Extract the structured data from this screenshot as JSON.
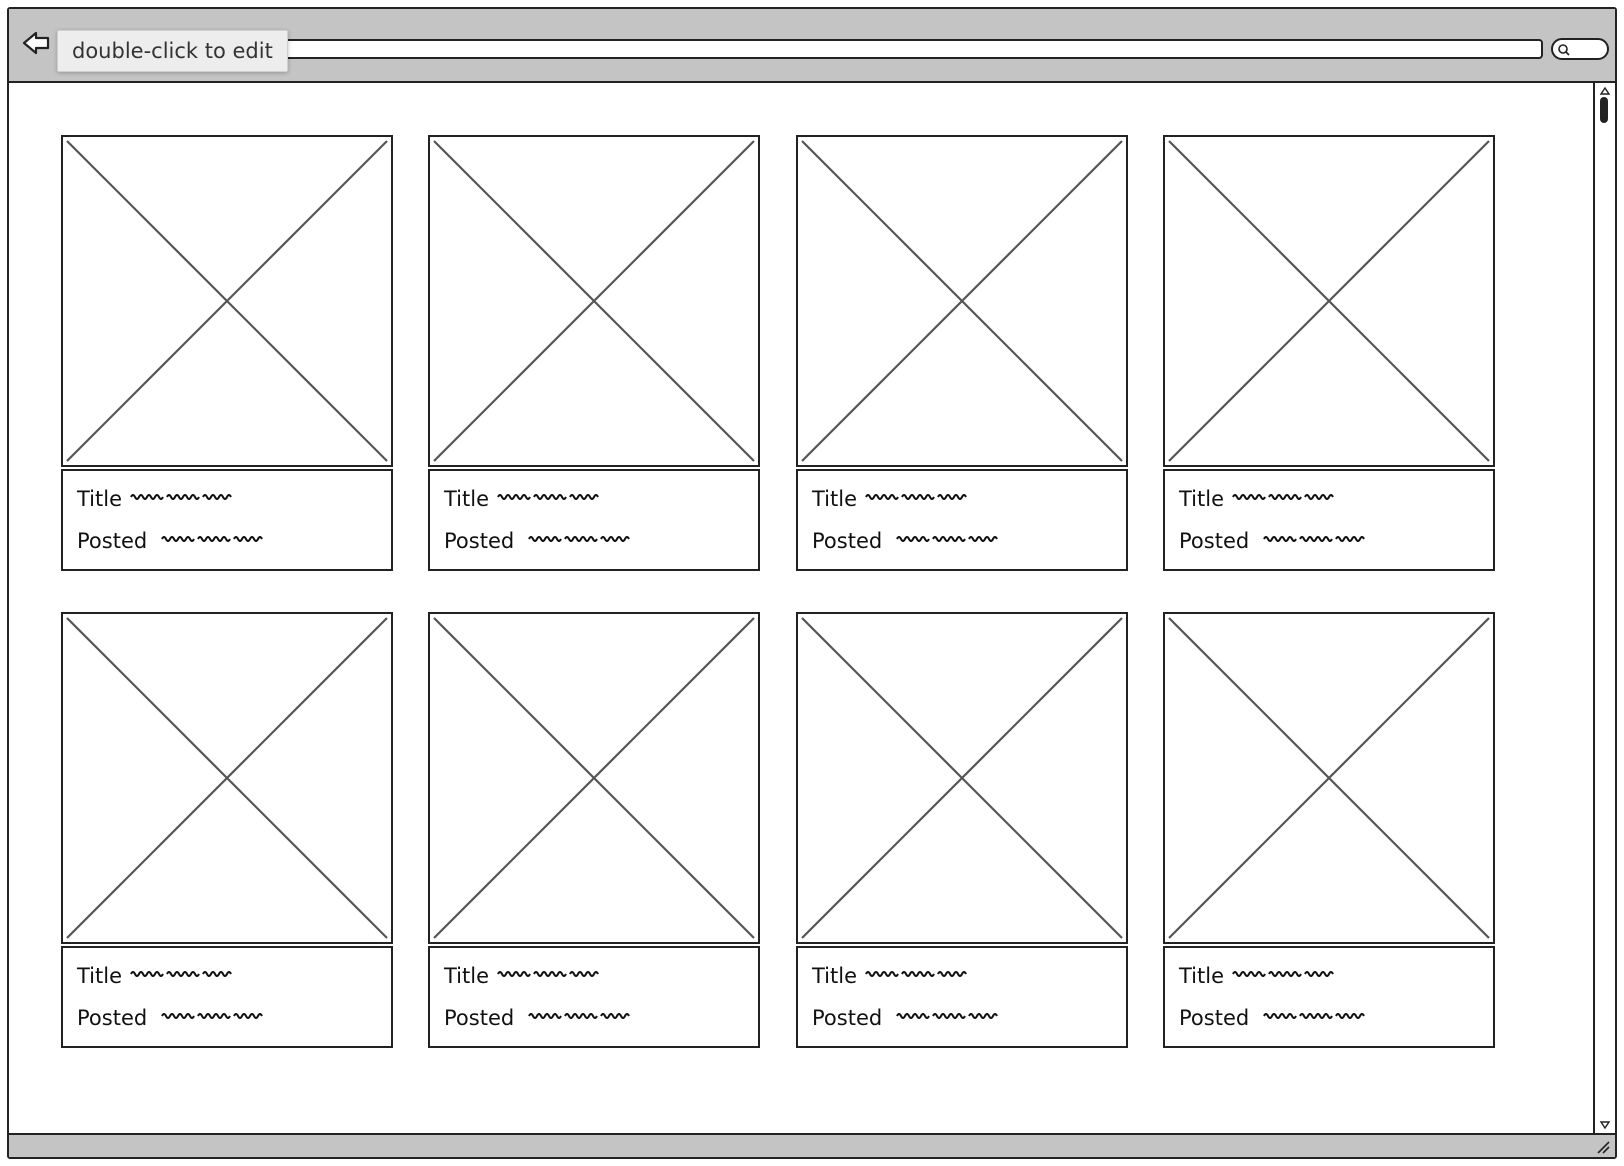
{
  "browser": {
    "back_icon": "back-arrow-icon",
    "tooltip": "double-click to edit",
    "search_icon": "search-icon"
  },
  "grid": {
    "cards": [
      {
        "title_label": "Title",
        "posted_label": "Posted"
      },
      {
        "title_label": "Title",
        "posted_label": "Posted"
      },
      {
        "title_label": "Title",
        "posted_label": "Posted"
      },
      {
        "title_label": "Title",
        "posted_label": "Posted"
      },
      {
        "title_label": "Title",
        "posted_label": "Posted"
      },
      {
        "title_label": "Title",
        "posted_label": "Posted"
      },
      {
        "title_label": "Title",
        "posted_label": "Posted"
      },
      {
        "title_label": "Title",
        "posted_label": "Posted"
      }
    ]
  },
  "colors": {
    "chrome": "#c4c4c4",
    "stroke": "#222222",
    "placeholder_cross": "#555555"
  }
}
